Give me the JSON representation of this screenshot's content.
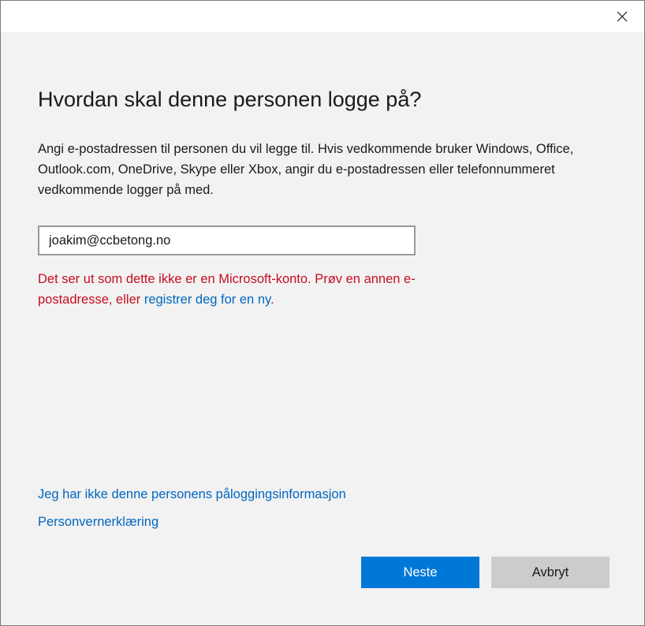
{
  "dialog": {
    "title": "Hvordan skal denne personen logge på?",
    "description": "Angi e-postadressen til personen du vil legge til. Hvis vedkommende bruker Windows, Office, Outlook.com, OneDrive, Skype eller Xbox, angir du e-postadressen eller telefonnummeret vedkommende logger på med.",
    "email_value": "joakim@ccbetong.no",
    "error": {
      "text": "Det ser ut som dette ikke er en Microsoft-konto. Prøv en annen e-postadresse, eller ",
      "link_text": "registrer deg for en ny",
      "suffix": "."
    },
    "links": {
      "no_info": "Jeg har ikke denne personens påloggingsinformasjon",
      "privacy": "Personvernerklæring"
    },
    "buttons": {
      "next": "Neste",
      "cancel": "Avbryt"
    },
    "icons": {
      "close": "close-icon"
    },
    "colors": {
      "accent": "#0078d7",
      "link": "#0067c0",
      "error": "#c50f1f",
      "cancel_bg": "#cccccc",
      "background": "#f2f2f2"
    }
  }
}
